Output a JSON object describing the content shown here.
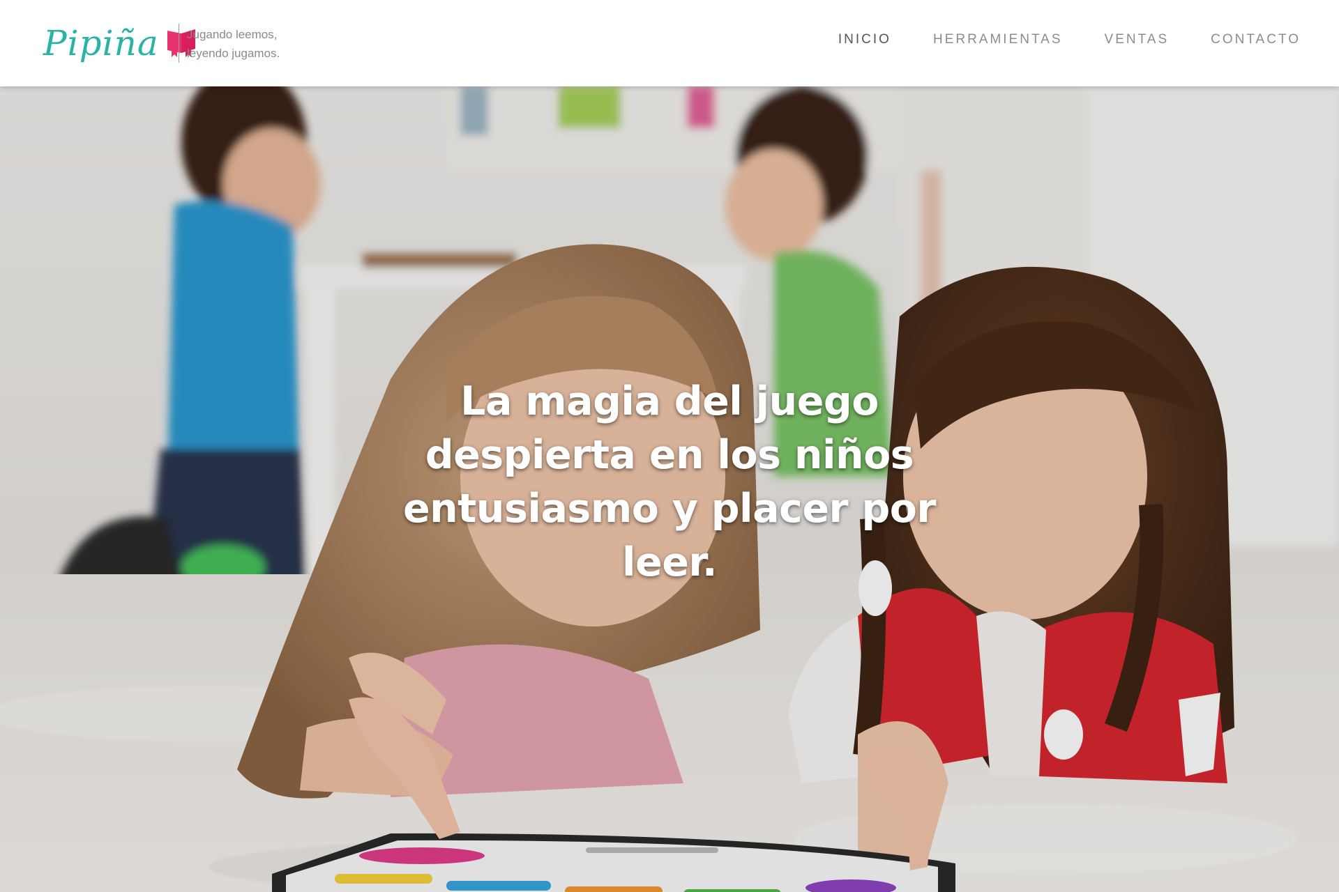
{
  "brand": {
    "name": "Pipiña",
    "tagline_line1": "Jugando leemos,",
    "tagline_line2": "leyendo jugamos.",
    "primary_color": "#27b3a5",
    "accent_color": "#e8336e",
    "logo_icon": "pink-book-icon"
  },
  "nav": {
    "items": [
      {
        "label": "INICIO",
        "active": true
      },
      {
        "label": "HERRAMIENTAS",
        "active": false
      },
      {
        "label": "VENTAS",
        "active": false
      },
      {
        "label": "CONTACTO",
        "active": false
      }
    ]
  },
  "hero": {
    "headline": "La magia del juego despierta en los niños entusiasmo y placer por leer.",
    "background": "photo-children-reading-tablet"
  }
}
